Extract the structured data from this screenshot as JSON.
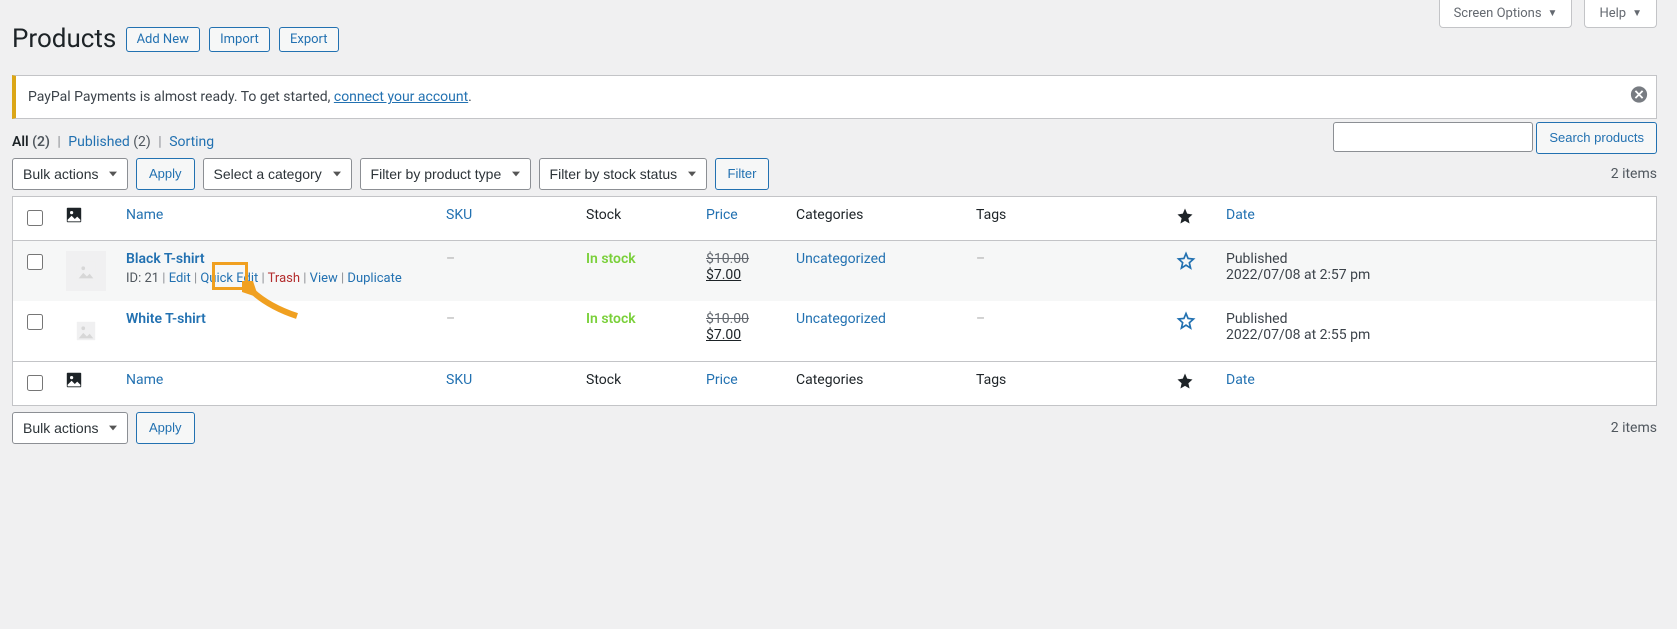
{
  "top": {
    "screen_options": "Screen Options",
    "help": "Help"
  },
  "page": {
    "title": "Products",
    "add_new": "Add New",
    "import": "Import",
    "export": "Export"
  },
  "notice": {
    "text_before": "PayPal Payments is almost ready. To get started, ",
    "link": "connect your account",
    "text_after": "."
  },
  "filters_links": {
    "all_label": "All",
    "all_count": "(2)",
    "published_label": "Published",
    "published_count": "(2)",
    "sorting": "Sorting"
  },
  "search": {
    "button": "Search products"
  },
  "bulk": {
    "label": "Bulk actions",
    "apply": "Apply"
  },
  "catfilter": "Select a category",
  "typefilter": "Filter by product type",
  "stockfilter": "Filter by stock status",
  "filter_btn": "Filter",
  "count_text": "2 items",
  "columns": {
    "name": "Name",
    "sku": "SKU",
    "stock": "Stock",
    "price": "Price",
    "categories": "Categories",
    "tags": "Tags",
    "date": "Date"
  },
  "rows": [
    {
      "title": "Black T-shirt",
      "id_prefix": "ID: 21",
      "actions": {
        "edit": "Edit",
        "quick_edit": "Quick Edit",
        "trash": "Trash",
        "view": "View",
        "duplicate": "Duplicate"
      },
      "sku": "–",
      "stock": "In stock",
      "price_old": "$10.00",
      "price_new": "$7.00",
      "category": "Uncategorized",
      "tags": "–",
      "status": "Published",
      "date": "2022/07/08 at 2:57 pm"
    },
    {
      "title": "White T-shirt",
      "sku": "–",
      "stock": "In stock",
      "price_old": "$10.00",
      "price_new": "$7.00",
      "category": "Uncategorized",
      "tags": "–",
      "status": "Published",
      "date": "2022/07/08 at 2:55 pm"
    }
  ]
}
